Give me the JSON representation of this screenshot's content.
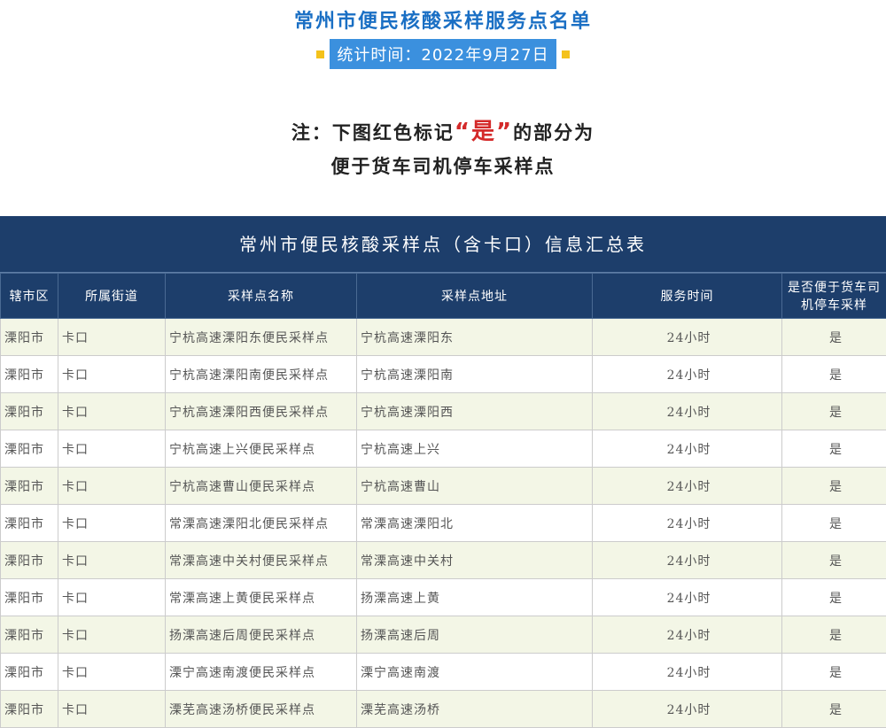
{
  "header": {
    "title": "常州市便民核酸采样服务点名单",
    "date_label": "统计时间：2022年9月27日",
    "note_prefix": "注：下图",
    "note_red_mark": "红色标记",
    "note_quote": "“是”",
    "note_suffix": "的部分为",
    "note_line2": "便于货车司机停车采样点"
  },
  "table": {
    "title": "常州市便民核酸采样点（含卡口）信息汇总表",
    "columns": [
      "辖市区",
      "所属街道",
      "采样点名称",
      "采样点地址",
      "服务时间",
      "是否便于货车司机停车采样"
    ],
    "rows": [
      [
        "溧阳市",
        "卡口",
        "宁杭高速溧阳东便民采样点",
        "宁杭高速溧阳东",
        "24小时",
        "是"
      ],
      [
        "溧阳市",
        "卡口",
        "宁杭高速溧阳南便民采样点",
        "宁杭高速溧阳南",
        "24小时",
        "是"
      ],
      [
        "溧阳市",
        "卡口",
        "宁杭高速溧阳西便民采样点",
        "宁杭高速溧阳西",
        "24小时",
        "是"
      ],
      [
        "溧阳市",
        "卡口",
        "宁杭高速上兴便民采样点",
        "宁杭高速上兴",
        "24小时",
        "是"
      ],
      [
        "溧阳市",
        "卡口",
        "宁杭高速曹山便民采样点",
        "宁杭高速曹山",
        "24小时",
        "是"
      ],
      [
        "溧阳市",
        "卡口",
        "常溧高速溧阳北便民采样点",
        "常溧高速溧阳北",
        "24小时",
        "是"
      ],
      [
        "溧阳市",
        "卡口",
        "常溧高速中关村便民采样点",
        "常溧高速中关村",
        "24小时",
        "是"
      ],
      [
        "溧阳市",
        "卡口",
        "常溧高速上黄便民采样点",
        "扬溧高速上黄",
        "24小时",
        "是"
      ],
      [
        "溧阳市",
        "卡口",
        "扬溧高速后周便民采样点",
        "扬溧高速后周",
        "24小时",
        "是"
      ],
      [
        "溧阳市",
        "卡口",
        "溧宁高速南渡便民采样点",
        "溧宁高速南渡",
        "24小时",
        "是"
      ],
      [
        "溧阳市",
        "卡口",
        "溧芜高速汤桥便民采样点",
        "溧芜高速汤桥",
        "24小时",
        "是"
      ]
    ]
  },
  "colors": {
    "title_blue": "#1a6fc4",
    "date_bg": "#3b90de",
    "table_header_bg": "#1d3e6b",
    "flag_red": "#d42a2a",
    "row_tint": "#f3f6e6"
  }
}
